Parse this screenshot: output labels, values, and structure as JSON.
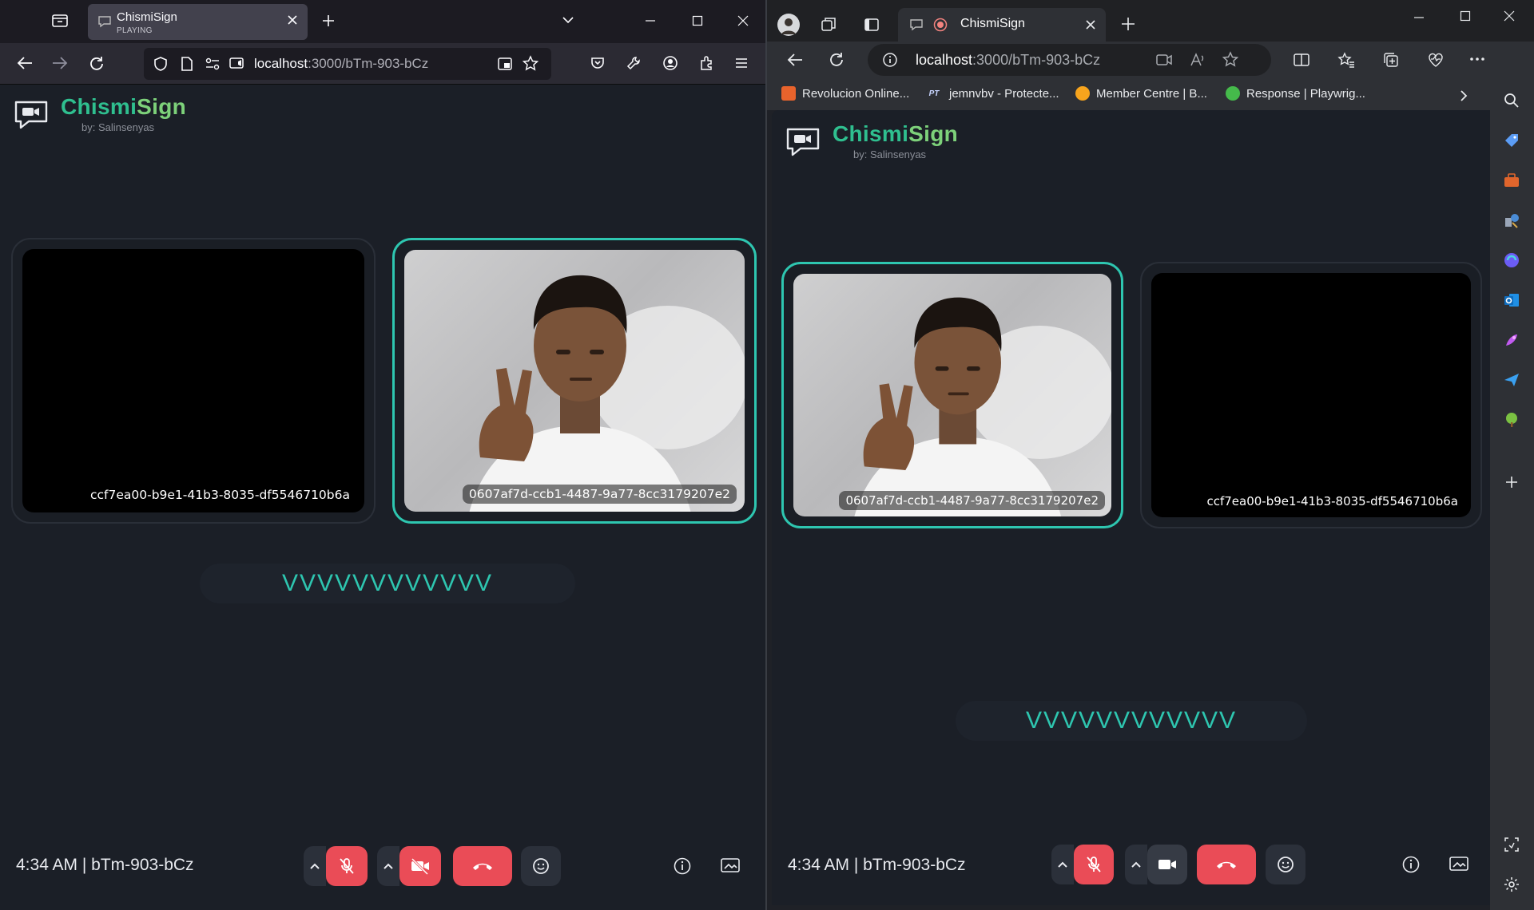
{
  "left_window": {
    "tab": {
      "title": "ChismiSign",
      "subtitle": "PLAYING"
    },
    "url": {
      "host": "localhost",
      "path": ":3000/bTm-903-bCz"
    },
    "app": {
      "brand_part1": "Chismi",
      "brand_part2": "Sign",
      "byline": "by: Salinsenyas",
      "tiles": [
        {
          "id": "ccf7ea00-b9e1-41b3-8035-df5546710b6a",
          "has_video": false,
          "active": false
        },
        {
          "id": "0607af7d-ccb1-4487-9a77-8cc3179207e2",
          "has_video": true,
          "active": true
        }
      ],
      "caption": "VVVVVVVVVVVV",
      "status": "4:34 AM | bTm-903-bCz"
    }
  },
  "right_window": {
    "tab": {
      "title": "ChismiSign"
    },
    "url": {
      "host": "localhost",
      "path": ":3000/bTm-903-bCz"
    },
    "favorites": [
      {
        "label": "Revolucion Online...",
        "icon_text": "",
        "color": "#e8632c"
      },
      {
        "label": "jemnvbv - Protecte...",
        "icon_text": "PT",
        "color": "#2e3035"
      },
      {
        "label": "Member Centre | B...",
        "icon_text": "",
        "color": "#f7a41d"
      },
      {
        "label": "Response | Playwrig...",
        "icon_text": "",
        "color": "#45ba4b"
      }
    ],
    "app": {
      "brand_part1": "Chismi",
      "brand_part2": "Sign",
      "byline": "by: Salinsenyas",
      "tiles": [
        {
          "id": "0607af7d-ccb1-4487-9a77-8cc3179207e2",
          "has_video": true,
          "active": true
        },
        {
          "id": "ccf7ea00-b9e1-41b3-8035-df5546710b6a",
          "has_video": false,
          "active": false
        }
      ],
      "caption": "VVVVVVVVVVVV",
      "status": "4:34 AM | bTm-903-bCz"
    }
  },
  "colors": {
    "accent": "#2ec6b0",
    "brand_green": "#2fbf8f",
    "danger": "#ea4c57",
    "page_bg": "#1b1f27"
  }
}
